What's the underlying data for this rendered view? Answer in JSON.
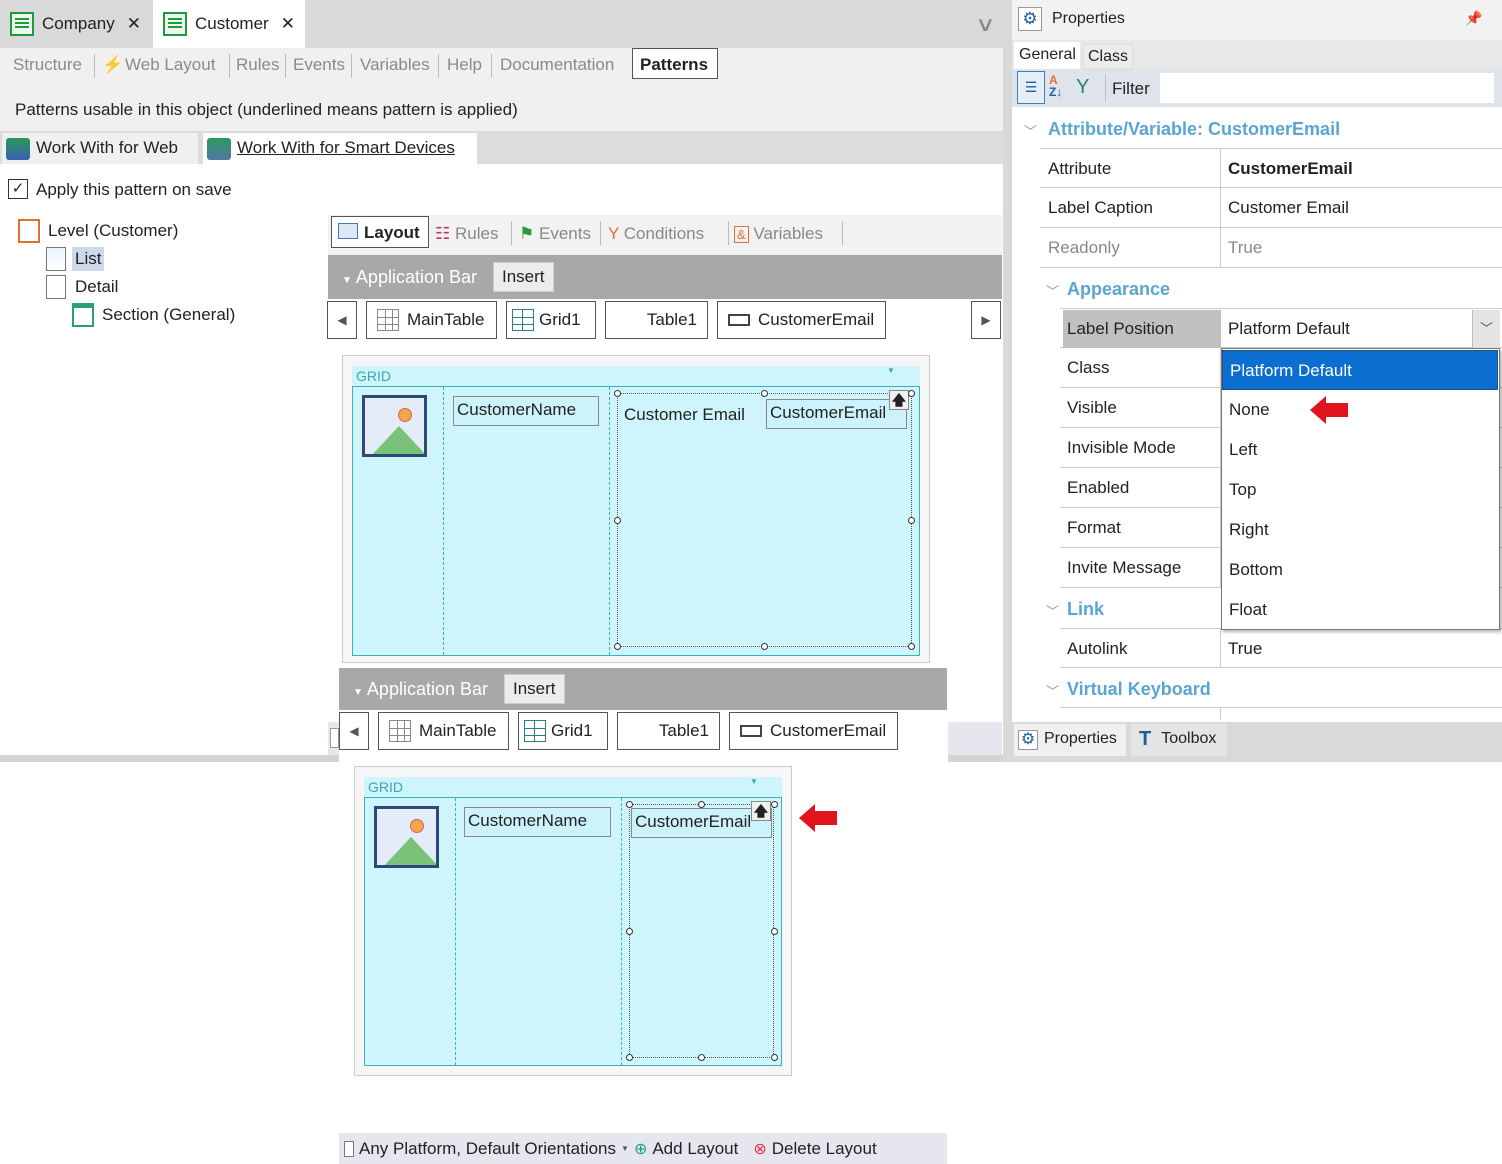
{
  "doc_tabs": [
    {
      "label": "Company",
      "close": "✕"
    },
    {
      "label": "Customer",
      "close": "✕"
    }
  ],
  "editor_tabs": [
    "Structure",
    "Web Layout",
    "Rules",
    "Events",
    "Variables",
    "Help",
    "Documentation",
    "Patterns"
  ],
  "patterns_caption": "Patterns usable in this object (underlined means pattern is applied)",
  "pattern_tabs": [
    "Work With for Web",
    "Work With for Smart Devices"
  ],
  "apply_on_save": {
    "label": "Apply this pattern on save",
    "checked": true
  },
  "tree": {
    "level": "Level (Customer)",
    "list": "List",
    "detail": "Detail",
    "section": "Section (General)"
  },
  "layout_tabs": [
    "Layout",
    "Rules",
    "Events",
    "Conditions",
    "Variables"
  ],
  "app_bar": {
    "label": "Application Bar",
    "insert": "Insert"
  },
  "breadcrumb": [
    "MainTable",
    "Grid1",
    "Table1",
    "CustomerEmail"
  ],
  "grid": {
    "header": "GRID",
    "name_field": "CustomerName",
    "email_label": "Customer Email",
    "email_field": "CustomerEmail"
  },
  "bottom_bar": {
    "platform": "Any Platform, Default Orientations",
    "add": "Add Layout",
    "delete": "Delete Layout"
  },
  "properties": {
    "title": "Properties",
    "tabs": [
      "General",
      "Class"
    ],
    "filter_label": "Filter",
    "filter_value": "",
    "categories": [
      "Attribute/Variable: CustomerEmail",
      "Appearance",
      "Link",
      "Virtual Keyboard"
    ],
    "rows": [
      {
        "key": "Attribute",
        "value": "CustomerEmail"
      },
      {
        "key": "Label Caption",
        "value": "Customer Email"
      },
      {
        "key": "Readonly",
        "value": "True"
      },
      {
        "key": "Label Position",
        "value": "Platform Default"
      },
      {
        "key": "Class",
        "value": ""
      },
      {
        "key": "Visible",
        "value": ""
      },
      {
        "key": "Invisible Mode",
        "value": ""
      },
      {
        "key": "Enabled",
        "value": ""
      },
      {
        "key": "Format",
        "value": ""
      },
      {
        "key": "Invite Message",
        "value": ""
      },
      {
        "key": "Autolink",
        "value": "True"
      }
    ],
    "dropdown_options": [
      "Platform Default",
      "None",
      "Left",
      "Top",
      "Right",
      "Bottom",
      "Float"
    ],
    "dropdown_selected": "Platform Default",
    "bottom_tabs": [
      "Properties",
      "Toolbox"
    ]
  },
  "colors": {
    "accent": "#0a6fd0",
    "category": "#5aa6d2",
    "arrow": "#e0141e",
    "grid_bg": "#cff5fc"
  }
}
